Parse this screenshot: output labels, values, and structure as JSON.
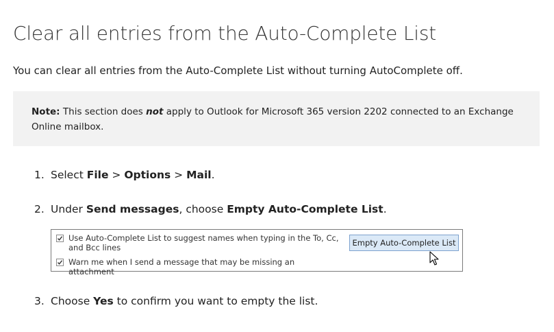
{
  "title": "Clear all entries from the Auto-Complete List",
  "intro": "You can clear all entries from the Auto-Complete List without turning AutoComplete off.",
  "note": {
    "label": "Note:",
    "text_before": " This section does ",
    "emphasis": "not",
    "text_after": " apply to Outlook for Microsoft 365 version 2202 connected to an Exchange",
    "line2": "Online mailbox."
  },
  "steps": [
    {
      "num": "1.",
      "parts": [
        "Select ",
        "File",
        " > ",
        "Options",
        " > ",
        "Mail",
        "."
      ]
    },
    {
      "num": "2.",
      "parts": [
        "Under ",
        "Send messages",
        ", choose ",
        "Empty Auto-Complete List",
        "."
      ]
    },
    {
      "num": "3.",
      "parts": [
        "Choose ",
        "Yes",
        " to confirm you want to empty the list."
      ]
    }
  ],
  "dialog": {
    "checkbox1_label": "Use Auto-Complete List to suggest names when typing in the To, Cc, and Bcc lines",
    "checkbox1_checked": true,
    "checkbox2_label": "Warn me when I send a message that may be missing an attachment",
    "checkbox2_checked": true,
    "button_label": "Empty Auto-Complete List"
  },
  "icons": {
    "checkmark": "checkmark-icon",
    "cursor": "mouse-pointer-icon"
  },
  "colors": {
    "note_background": "#f2f2f2",
    "button_background": "#dbe9f7",
    "button_border": "#7da2ce"
  }
}
